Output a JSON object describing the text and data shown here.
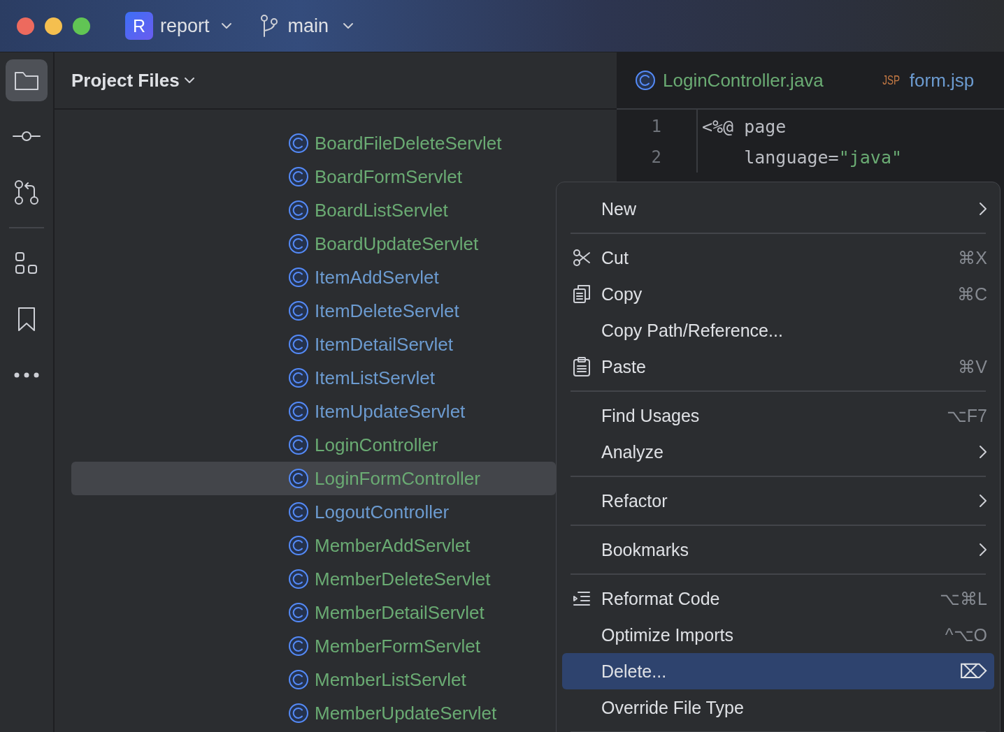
{
  "title_bar": {
    "project": {
      "badge": "R",
      "name": "report"
    },
    "branch": {
      "name": "main"
    }
  },
  "toolbar": {
    "top_items": [
      {
        "selected": true
      },
      {
        "selected": false
      },
      {
        "selected": false
      }
    ],
    "bottom_items": [
      {
        "selected": false
      },
      {
        "selected": false
      },
      {
        "selected": false
      }
    ]
  },
  "project_panel": {
    "title": "Project Files",
    "items": [
      {
        "name": "BoardFileDeleteServlet",
        "color": "#6aab73",
        "selected": false
      },
      {
        "name": "BoardFormServlet",
        "color": "#6aab73",
        "selected": false
      },
      {
        "name": "BoardListServlet",
        "color": "#6aab73",
        "selected": false
      },
      {
        "name": "BoardUpdateServlet",
        "color": "#6aab73",
        "selected": false
      },
      {
        "name": "ItemAddServlet",
        "color": "#6c9bd0",
        "selected": false
      },
      {
        "name": "ItemDeleteServlet",
        "color": "#6c9bd0",
        "selected": false
      },
      {
        "name": "ItemDetailServlet",
        "color": "#6c9bd0",
        "selected": false
      },
      {
        "name": "ItemListServlet",
        "color": "#6c9bd0",
        "selected": false
      },
      {
        "name": "ItemUpdateServlet",
        "color": "#6c9bd0",
        "selected": false
      },
      {
        "name": "LoginController",
        "color": "#6aab73",
        "selected": false
      },
      {
        "name": "LoginFormController",
        "color": "#6aab73",
        "selected": true
      },
      {
        "name": "LogoutController",
        "color": "#6c9bd0",
        "selected": false
      },
      {
        "name": "MemberAddServlet",
        "color": "#6aab73",
        "selected": false
      },
      {
        "name": "MemberDeleteServlet",
        "color": "#6aab73",
        "selected": false
      },
      {
        "name": "MemberDetailServlet",
        "color": "#6aab73",
        "selected": false
      },
      {
        "name": "MemberFormServlet",
        "color": "#6aab73",
        "selected": false
      },
      {
        "name": "MemberListServlet",
        "color": "#6aab73",
        "selected": false
      },
      {
        "name": "MemberUpdateServlet",
        "color": "#6aab73",
        "selected": false
      }
    ]
  },
  "editor": {
    "tabs": [
      {
        "kind": "java",
        "label": "LoginController.java",
        "color": "#6aab73"
      },
      {
        "kind": "jsp",
        "badge": "JSP",
        "label": "form.jsp",
        "color": "#6c9bd0"
      }
    ],
    "lines": [
      {
        "number": "1",
        "segments": [
          {
            "kind": "plain",
            "text": "<%@ page"
          }
        ]
      },
      {
        "number": "2",
        "segments": [
          {
            "kind": "plain",
            "text": "    language="
          },
          {
            "kind": "string",
            "text": "\"java\""
          }
        ]
      }
    ]
  },
  "context_menu": {
    "items": [
      {
        "kind": "submenu",
        "label": "New",
        "selected": false
      },
      {
        "kind": "separator"
      },
      {
        "kind": "item",
        "label": "Cut",
        "shortcut": "⌘X",
        "selected": false
      },
      {
        "kind": "item",
        "label": "Copy",
        "shortcut": "⌘C",
        "selected": false
      },
      {
        "kind": "item",
        "label": "Copy Path/Reference...",
        "selected": false
      },
      {
        "kind": "item",
        "label": "Paste",
        "shortcut": "⌘V",
        "selected": false
      },
      {
        "kind": "separator"
      },
      {
        "kind": "item",
        "label": "Find Usages",
        "shortcut": "⌥F7",
        "selected": false
      },
      {
        "kind": "submenu",
        "label": "Analyze",
        "selected": false
      },
      {
        "kind": "separator"
      },
      {
        "kind": "submenu",
        "label": "Refactor",
        "selected": false
      },
      {
        "kind": "separator"
      },
      {
        "kind": "submenu",
        "label": "Bookmarks",
        "selected": false
      },
      {
        "kind": "separator"
      },
      {
        "kind": "item",
        "label": "Reformat Code",
        "shortcut": "⌥⌘L",
        "selected": false
      },
      {
        "kind": "item",
        "label": "Optimize Imports",
        "shortcut": "^⌥O",
        "selected": false
      },
      {
        "kind": "item",
        "label": "Delete...",
        "shortcut": "⌦",
        "selected": true
      },
      {
        "kind": "item",
        "label": "Override File Type",
        "selected": false
      },
      {
        "kind": "separator"
      }
    ]
  }
}
